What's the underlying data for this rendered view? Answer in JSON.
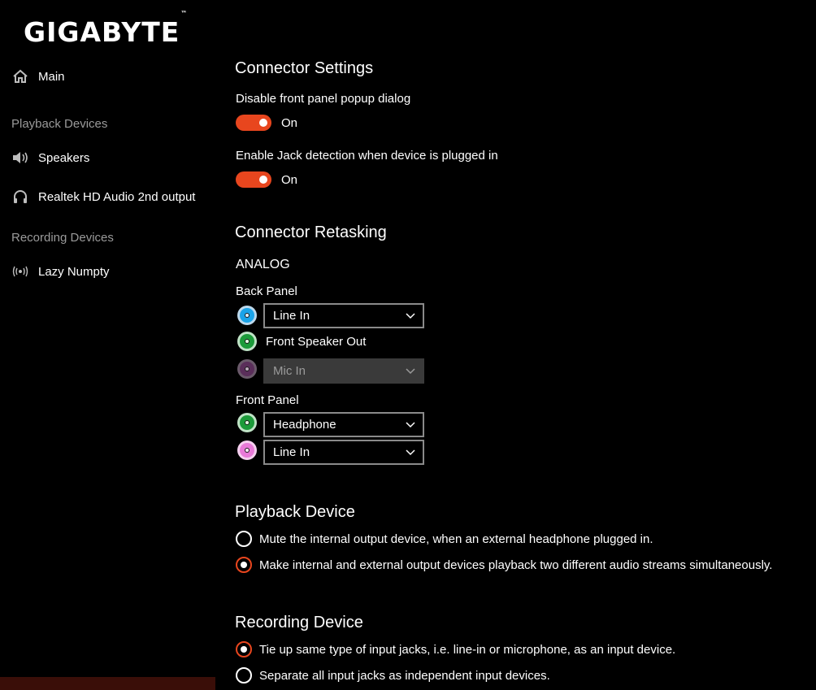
{
  "brand": {
    "name": "GIGABYTE",
    "tm": "™"
  },
  "sidebar": {
    "main_label": "Main",
    "playback_header": "Playback Devices",
    "playback_items": [
      "Speakers",
      "Realtek HD Audio 2nd output"
    ],
    "recording_header": "Recording Devices",
    "recording_items": [
      "Lazy Numpty"
    ]
  },
  "connector_settings": {
    "title": "Connector Settings",
    "popup_label": "Disable front panel popup dialog",
    "popup_state": "On",
    "jack_label": "Enable Jack detection when device is plugged in",
    "jack_state": "On"
  },
  "retasking": {
    "title": "Connector Retasking",
    "analog_label": "ANALOG",
    "back_panel_label": "Back Panel",
    "back_jack1": "Line In",
    "back_jack2": "Front Speaker Out",
    "back_jack3": "Mic In",
    "front_panel_label": "Front Panel",
    "front_jack1": "Headphone",
    "front_jack2": "Line In"
  },
  "playback_device": {
    "title": "Playback Device",
    "option1": "Mute the internal output device, when an external headphone plugged in.",
    "option2": "Make internal and external output devices playback two different audio streams simultaneously.",
    "selected": 2
  },
  "recording_device": {
    "title": "Recording Device",
    "option1": "Tie up same type of input jacks, i.e. line-in or microphone, as an input device.",
    "option2": "Separate all input jacks as independent input devices.",
    "selected": 1
  },
  "colors": {
    "accent": "#e8461e",
    "jack_blue": "#1aa3e8",
    "jack_green": "#1c9b3a",
    "jack_purple": "#6b3a6b",
    "jack_pink": "#e87ad8"
  },
  "icons": {
    "main": "home-icon",
    "speakers": "speaker-icon",
    "realtek": "headphones-icon",
    "recording": "microphone-wireless-icon"
  }
}
